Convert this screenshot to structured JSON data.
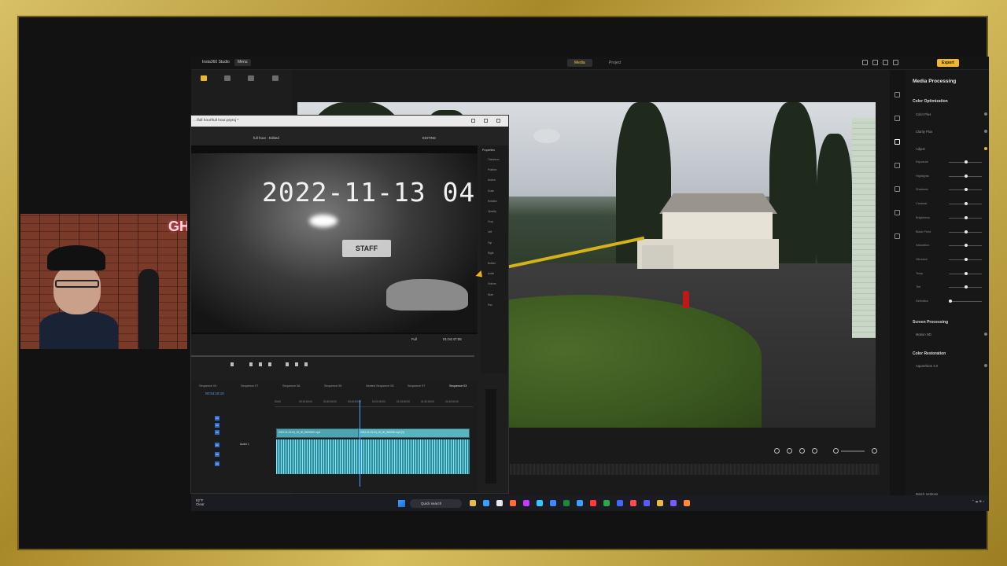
{
  "app": {
    "title": "Insta360 Studio",
    "menu_label": "Menu",
    "tabs": [
      "Media",
      "Project"
    ],
    "export_label": "Export"
  },
  "right_panel": {
    "title": "Media Processing",
    "sections": {
      "color_optimization": "Color Optimization",
      "screen_processing": "Screen Processing",
      "color_restoration": "Color Restoration"
    },
    "items": {
      "color_plus": "Color Plus",
      "clarity_plus": "Clarity Plus",
      "adjust": "Adjust",
      "motion_nd": "Motion ND",
      "aquavision": "AquaVision 3.0"
    },
    "sliders": [
      {
        "label": "Exposure",
        "value": 0.5
      },
      {
        "label": "Highlights",
        "value": 0.5
      },
      {
        "label": "Shadows",
        "value": 0.5
      },
      {
        "label": "Contrast",
        "value": 0.5
      },
      {
        "label": "Brightness",
        "value": 0.5
      },
      {
        "label": "Black Point",
        "value": 0.5
      },
      {
        "label": "Saturation",
        "value": 0.5
      },
      {
        "label": "Vibrance",
        "value": 0.5
      },
      {
        "label": "Temp",
        "value": 0.5
      },
      {
        "label": "Tint",
        "value": 0.5
      },
      {
        "label": "Definition",
        "value": 0.0
      }
    ],
    "batch_label": "Batch settings"
  },
  "premiere": {
    "window_title": "...\\full hour\\full hour.prproj *",
    "header_title": "full hour - Edited",
    "editing_label": "EDITING",
    "monitor_overlay": "2022-11-13 04",
    "sign_text": "STAFF",
    "timecode": "01:04:47:05",
    "fit_label": "Full",
    "properties_header": "Properties",
    "properties_items": [
      "Transform",
      "Position",
      "Anchor",
      "Scale",
      "Rotation",
      "Opacity",
      "Crop",
      "Left",
      "Top",
      "Right",
      "Bottom",
      "Audio",
      "Volume",
      "Mute",
      "Pan"
    ],
    "sequence_tabs": [
      "Sequence 04",
      "Sequence 07",
      "Sequence 08",
      "Sequence 05",
      "Nested Sequence 05",
      "Sequence 07",
      "Sequence 03"
    ],
    "timeline_tc": "00:54:18:10",
    "ruler_marks": [
      "00:00",
      "00:15:00:00",
      "00:30:00:00",
      "00:45:00:00",
      "01:00:00:00",
      "01:15:00:00",
      "01:30:00:00",
      "01:45:00:00"
    ],
    "clip_v1": "2022-11-13-04_15_00_N000000.mp4",
    "clip_v2": "2022-11-13-04_15_00_N00000.mp4 [V]",
    "audio_label": "Audio 1",
    "track_labels": [
      "V3",
      "V2",
      "V1",
      "A1",
      "A2",
      "A3"
    ]
  },
  "taskbar": {
    "temp": "82°F",
    "weather": "Clear",
    "search_placeholder": "Quick search"
  },
  "webcam": {
    "neon_text": "GH"
  },
  "colors": {
    "accent": "#f0b829",
    "frame_gold": "#c9a83d",
    "timeline_blue": "#4ea3ff",
    "clip_teal": "#4ea3b0"
  }
}
